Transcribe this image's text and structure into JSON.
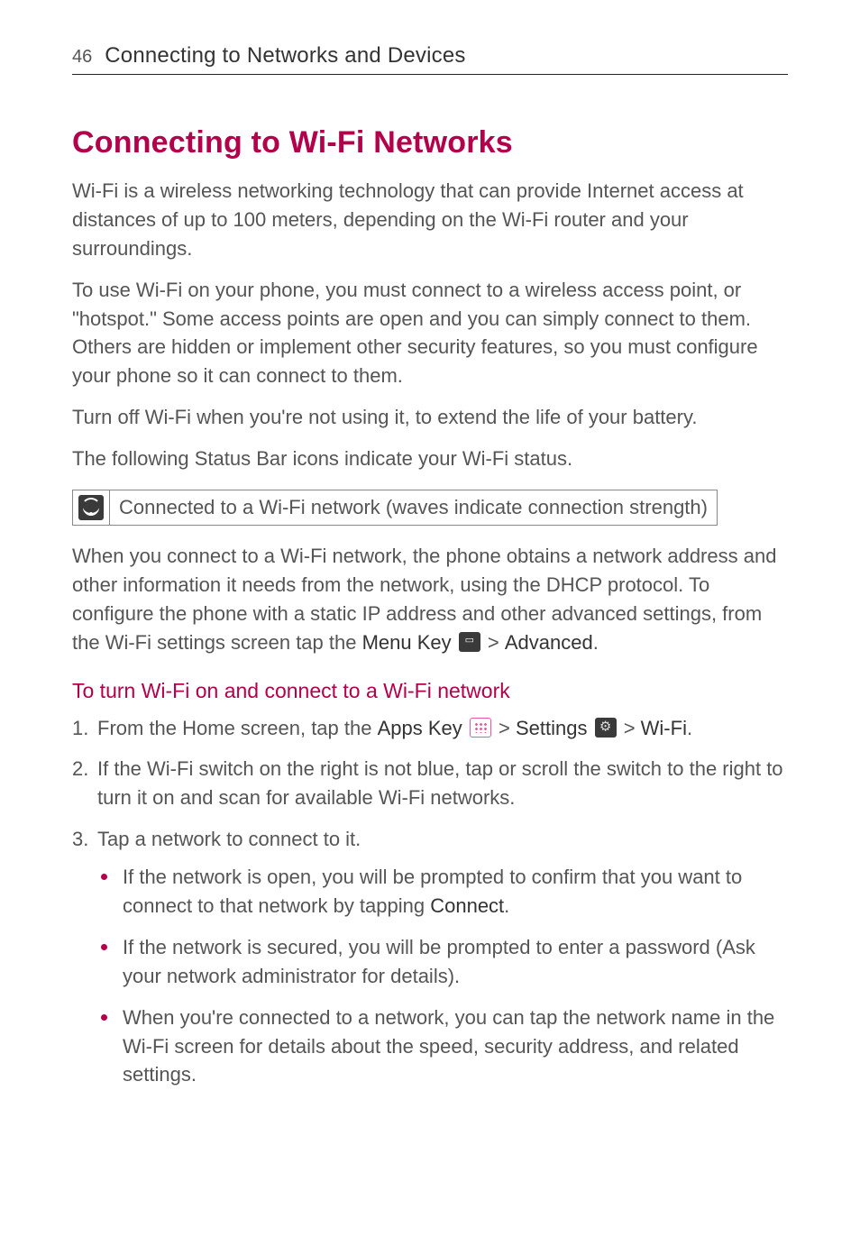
{
  "header": {
    "page_number": "46",
    "section_title": "Connecting to Networks and Devices"
  },
  "title": "Connecting to Wi-Fi Networks",
  "paragraphs": {
    "p1": "Wi-Fi is a wireless networking technology that can provide Internet access at distances of up to 100 meters, depending on the Wi-Fi router and your surroundings.",
    "p2": "To use Wi-Fi on your phone, you must connect to a wireless access point, or \"hotspot.\" Some access points are open and you can simply connect to them. Others are hidden or implement other security features, so you must configure your phone so it can connect to them.",
    "p3": "Turn off Wi-Fi when you're not using it, to extend the life of your battery.",
    "p4": "The following Status Bar icons indicate your Wi-Fi status."
  },
  "icon_row": {
    "text": "Connected to a Wi-Fi network (waves indicate connection strength)"
  },
  "after_icon": {
    "prefix": "When you connect to a Wi-Fi network, the phone obtains a network address and other information it needs from the network, using the DHCP protocol. To configure the phone with a static IP address and other advanced settings, from the Wi-Fi settings screen tap the ",
    "menu_key": "Menu Key",
    "gt": " > ",
    "advanced": "Advanced",
    "period": "."
  },
  "subhead": "To turn Wi-Fi on and connect to a Wi-Fi network",
  "steps": {
    "s1": {
      "prefix": "From the Home screen, tap the ",
      "apps_key": "Apps Key",
      "gt1": " > ",
      "settings": "Settings",
      "gt2": " > ",
      "wifi": "Wi-Fi",
      "period": "."
    },
    "s2": "If the Wi-Fi switch on the right is not blue, tap or scroll the switch to the right to turn it on and scan for available Wi-Fi networks.",
    "s3": "Tap a network to connect to it.",
    "bullets": {
      "b1": {
        "pre": "If the network is open, you will be prompted to confirm that you want to connect to that network by tapping ",
        "connect": "Connect",
        "post": "."
      },
      "b2": "If the network is secured, you will be prompted to enter a password (Ask your network administrator for details).",
      "b3": "When you're connected to a network, you can tap the network name in the Wi-Fi screen for details about the speed, security address, and related settings."
    }
  }
}
